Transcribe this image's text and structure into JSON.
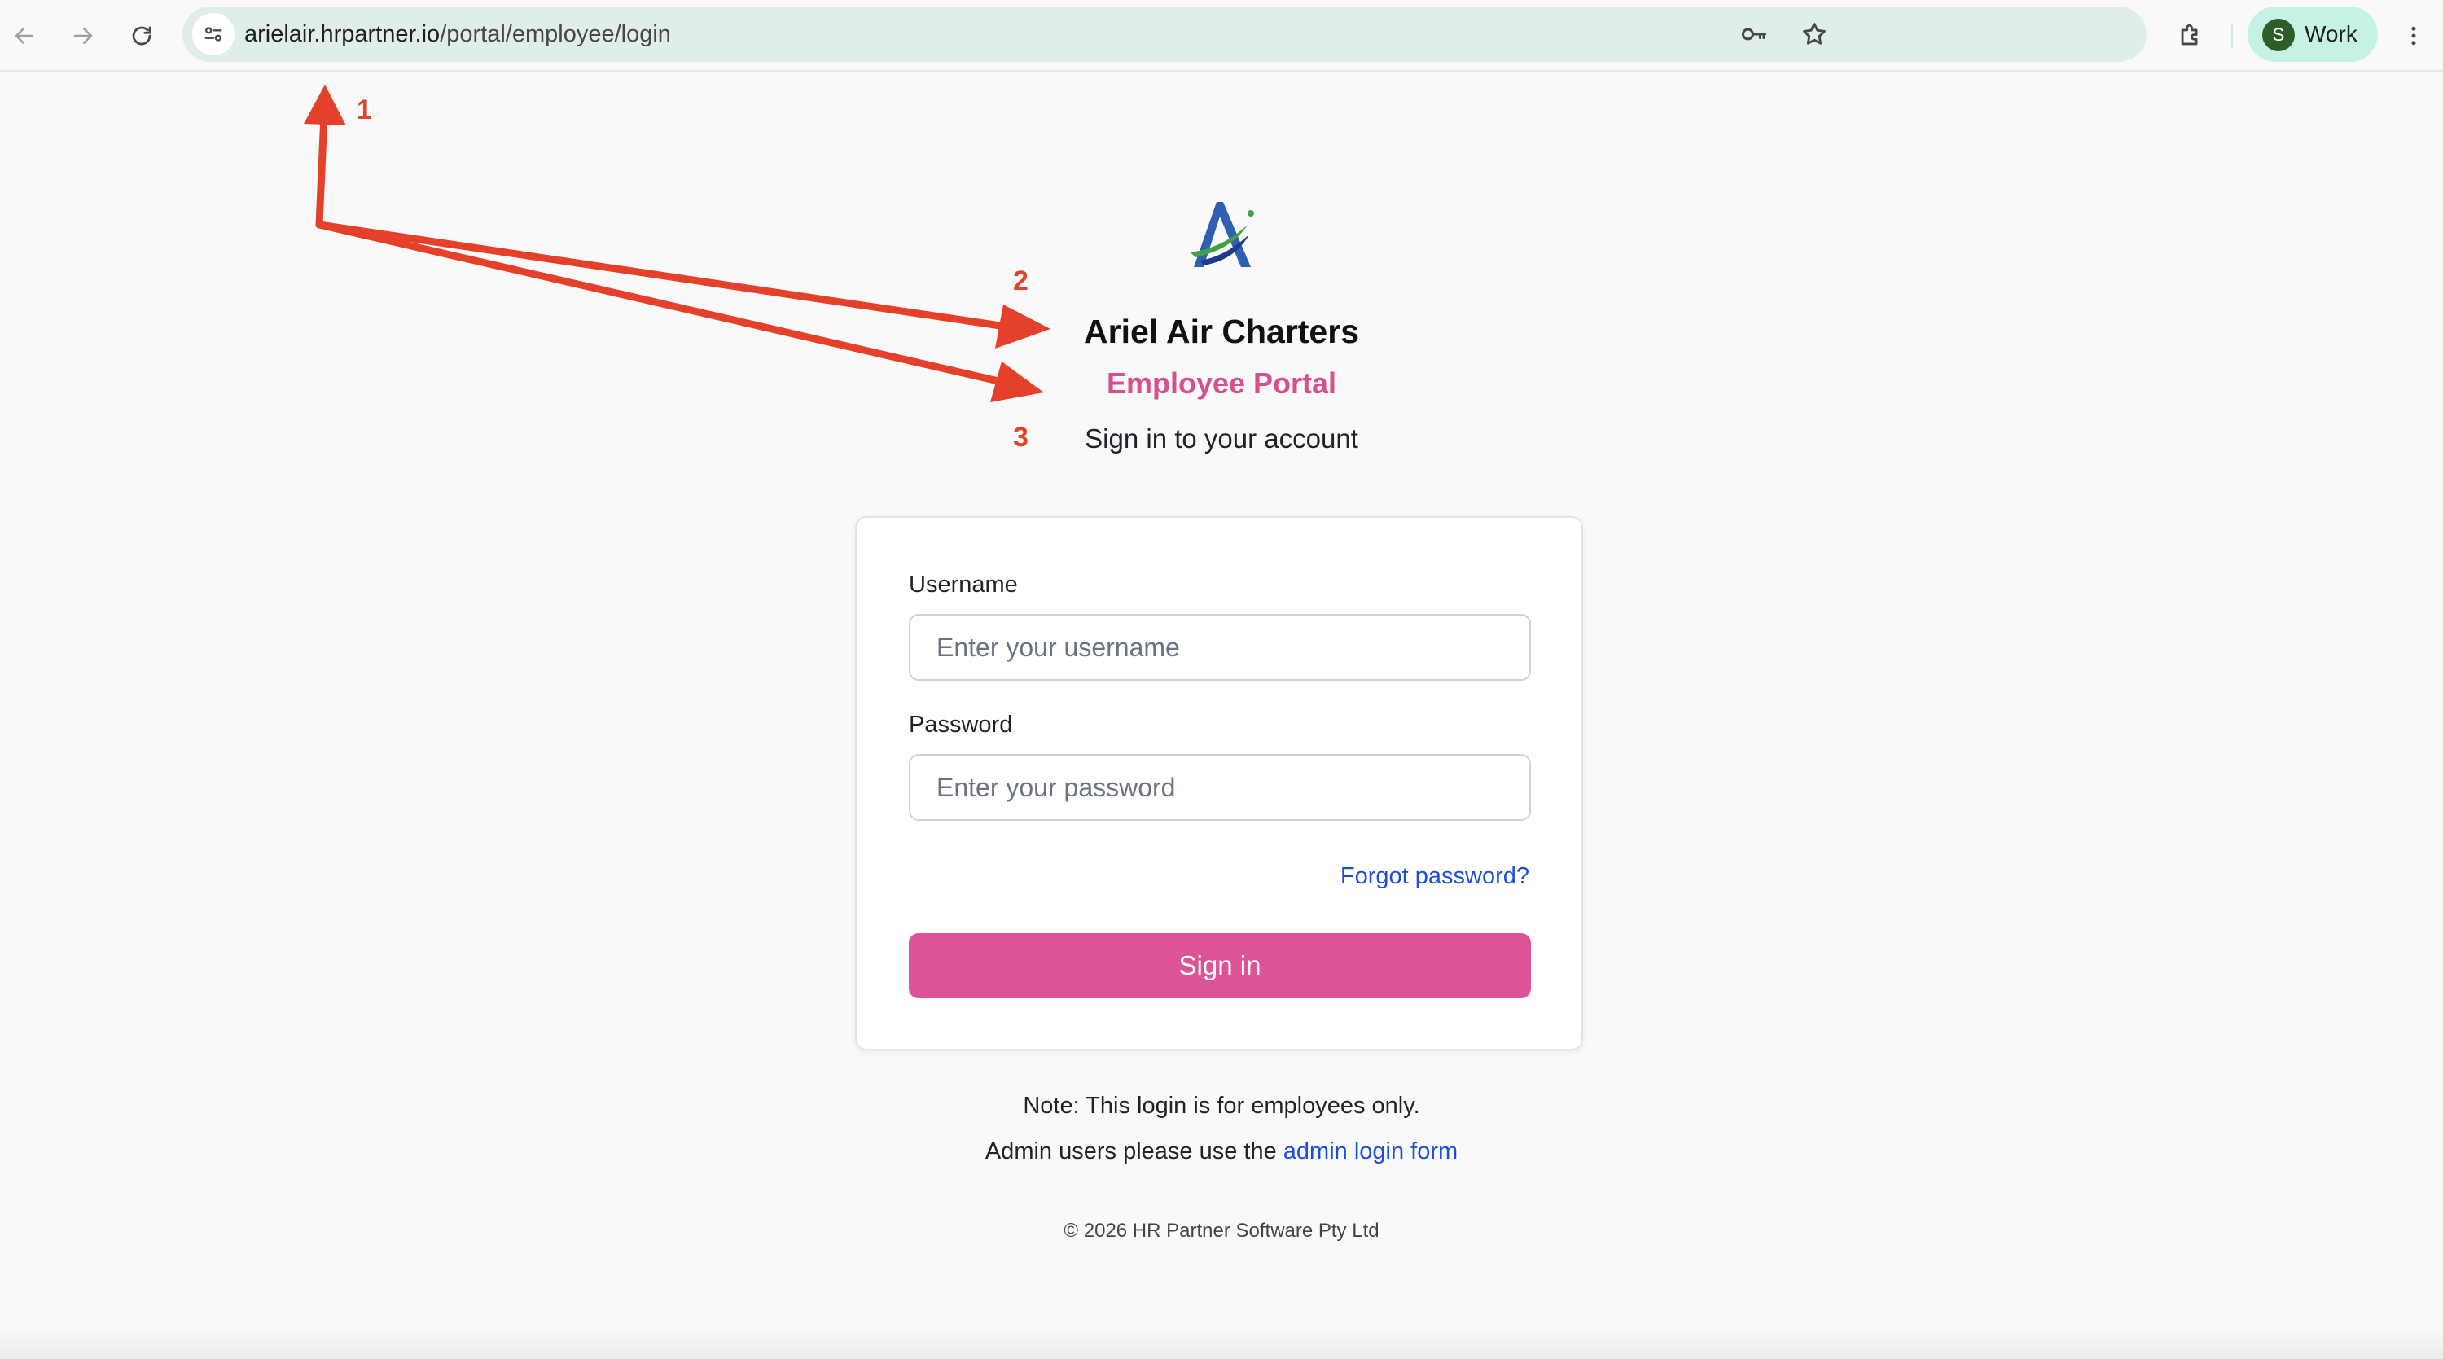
{
  "browser": {
    "url_host": "arielair.hrpartner.io",
    "url_path": "/portal/employee/login",
    "profile_initial": "S",
    "profile_label": "Work"
  },
  "page": {
    "company_name": "Ariel Air Charters",
    "portal_name": "Employee Portal",
    "subtitle": "Sign in to your account"
  },
  "form": {
    "username_label": "Username",
    "username_placeholder": "Enter your username",
    "password_label": "Password",
    "password_placeholder": "Enter your password",
    "forgot_link": "Forgot password?",
    "submit_label": "Sign in"
  },
  "notes": {
    "line1": "Note: This login is for employees only.",
    "line2_prefix": "Admin users please use the",
    "admin_link": "admin login form"
  },
  "footer": "© 2026 HR Partner Software Pty Ltd",
  "annotations": [
    "1",
    "2",
    "3"
  ],
  "colors": {
    "accent_pink": "#dc5497",
    "link_blue": "#1d4ed8",
    "annotation_red": "#e5402a",
    "omnibox_bg": "#dfeeea"
  }
}
